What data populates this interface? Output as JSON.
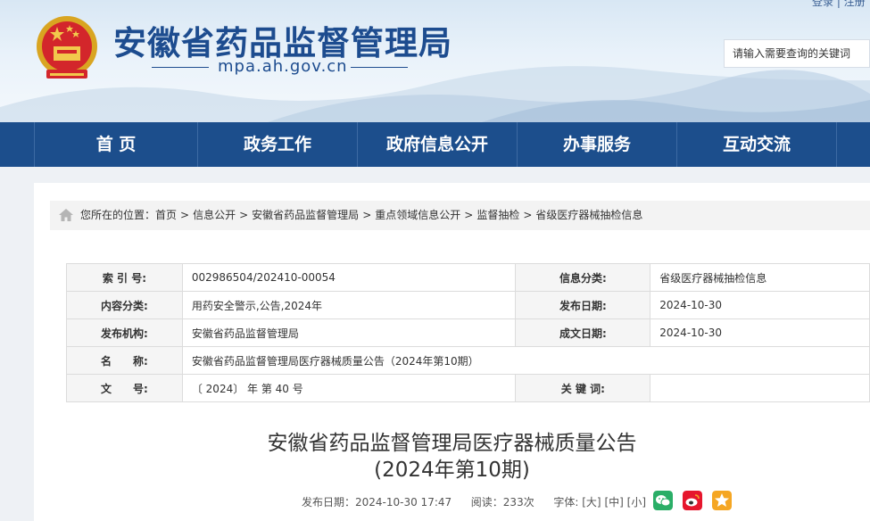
{
  "header": {
    "site_title": "安徽省药品监督管理局",
    "site_domain": "mpa.ah.gov.cn",
    "top_links": "登录 | 注册",
    "search_placeholder": "请输入需要查询的关键词"
  },
  "nav": {
    "items": [
      "首 页",
      "政务工作",
      "政府信息公开",
      "办事服务",
      "互动交流"
    ]
  },
  "breadcrumb": {
    "prefix": "您所在的位置：",
    "items": [
      "首页",
      "信息公开",
      "安徽省药品监督管理局",
      "重点领域信息公开",
      "监督抽检",
      "省级医疗器械抽检信息"
    ],
    "separator": ">"
  },
  "meta": {
    "index_label": "索 引 号:",
    "index_value": "002986504/202410-00054",
    "category_label": "信息分类:",
    "category_value": "省级医疗器械抽检信息",
    "content_label": "内容分类:",
    "content_value": "用药安全警示,公告,2024年",
    "publish_date_label": "发布日期:",
    "publish_date_value": "2024-10-30",
    "agency_label": "发布机构:",
    "agency_value": "安徽省药品监督管理局",
    "written_date_label": "成文日期:",
    "written_date_value": "2024-10-30",
    "name_label": "名　　称:",
    "name_value": "安徽省药品监督管理局医疗器械质量公告（2024年第10期）",
    "doc_no_label": "文　　号:",
    "doc_no_value": "〔 2024〕 年 第 40 号",
    "keywords_label": "关 键 词:",
    "keywords_value": ""
  },
  "article": {
    "title_line1": "安徽省药品监督管理局医疗器械质量公告",
    "title_line2": "(2024年第10期)",
    "publish_info": "发布日期：2024-10-30 17:47",
    "views": "阅读：233次",
    "font_label": "字体:",
    "font_large": "[大]",
    "font_medium": "[中]",
    "font_small": "[小]"
  },
  "colors": {
    "nav_bg": "#1c4e8c",
    "title_blue": "#1d4c8f",
    "wechat": "#2aae67",
    "weibo": "#e6162d",
    "qzone": "#f5a623"
  },
  "icons": [
    "national-emblem-icon",
    "home-icon",
    "wechat-icon",
    "weibo-icon",
    "qzone-icon"
  ]
}
